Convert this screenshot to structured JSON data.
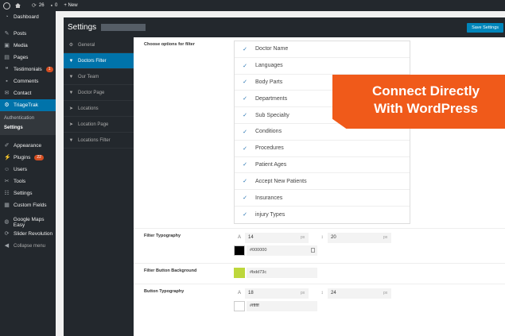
{
  "adminbar": {
    "comments_count": "26",
    "pending_count": "0",
    "new_label": "+ New"
  },
  "wpmenu": {
    "items_top": [
      {
        "label": "Dashboard",
        "icon": "dashboard-icon"
      }
    ],
    "items_main": [
      {
        "label": "Posts",
        "icon": "pin-icon"
      },
      {
        "label": "Media",
        "icon": "media-icon"
      },
      {
        "label": "Pages",
        "icon": "page-icon"
      },
      {
        "label": "Testimonials",
        "icon": "quote-icon",
        "badge": "1"
      },
      {
        "label": "Comments",
        "icon": "comment-icon"
      },
      {
        "label": "Contact",
        "icon": "mail-icon"
      },
      {
        "label": "TriageTrak",
        "icon": "gear-icon",
        "active": true
      }
    ],
    "submenu": [
      {
        "label": "Authentication"
      },
      {
        "label": "Settings",
        "current": true
      }
    ],
    "items_bottom": [
      {
        "label": "Appearance",
        "icon": "brush-icon"
      },
      {
        "label": "Plugins",
        "icon": "plug-icon",
        "badge": "22"
      },
      {
        "label": "Users",
        "icon": "user-icon"
      },
      {
        "label": "Tools",
        "icon": "wrench-icon"
      },
      {
        "label": "Settings",
        "icon": "settings-icon"
      },
      {
        "label": "Custom Fields",
        "icon": "grid-icon"
      }
    ],
    "items_extra": [
      {
        "label": "Google Maps Easy",
        "icon": "globe-icon"
      },
      {
        "label": "Slider Revolution",
        "icon": "refresh-icon"
      }
    ],
    "collapse_label": "Collapse menu"
  },
  "plugin": {
    "title": "Settings",
    "save_label": "Save Settings",
    "nav": [
      {
        "label": "General",
        "icon": "gear-icon"
      },
      {
        "label": "Doctors Filter",
        "icon": "filter-icon",
        "active": true
      },
      {
        "label": "Our Team",
        "icon": "filter-icon"
      },
      {
        "label": "Doctor Page",
        "icon": "filter-icon"
      },
      {
        "label": "Locations",
        "icon": "location-icon"
      },
      {
        "label": "Location Page",
        "icon": "location-icon"
      },
      {
        "label": "Locations Filter",
        "icon": "filter-icon"
      }
    ],
    "filter_options_label": "Choose options for filter",
    "filter_options": [
      "Doctor Name",
      "Languages",
      "Body Parts",
      "Departments",
      "Sub Specialty",
      "Conditions",
      "Procedures",
      "Patient Ages",
      "Accept New Patients",
      "Insurances",
      "injury Types"
    ],
    "filter_typography": {
      "label": "Filter Typography",
      "size": "14",
      "size_unit": "px",
      "line_height": "20",
      "line_unit": "px",
      "color": "#000000"
    },
    "filter_button_bg": {
      "label": "Filter Button Background",
      "color": "#bdd73c"
    },
    "button_typography": {
      "label": "Button Typography",
      "size": "18",
      "size_unit": "px",
      "line_height": "24",
      "line_unit": "px",
      "color": "#ffffff"
    }
  },
  "banner": {
    "line1": "Connect Directly",
    "line2": "With WordPress"
  },
  "colors": {
    "accent": "#0073aa",
    "banner": "#f05a1a",
    "dark": "#23282d"
  }
}
